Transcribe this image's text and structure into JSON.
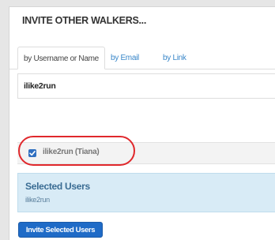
{
  "modal": {
    "title": "INVITE OTHER WALKERS..."
  },
  "tabs": [
    {
      "label": "by Username or Name",
      "active": true
    },
    {
      "label": "by Email",
      "active": false
    },
    {
      "label": "by Link",
      "active": false
    }
  ],
  "search": {
    "value": "ilike2run"
  },
  "results": [
    {
      "label": "ilike2run (Tiana)",
      "checked": true
    }
  ],
  "selected": {
    "title": "Selected Users",
    "users": [
      "ilike2run"
    ]
  },
  "actions": {
    "invite_label": "Invite Selected Users"
  },
  "colors": {
    "accent": "#1f6bc7",
    "link": "#3a87c9",
    "selected_bg": "#d8ebf6",
    "highlight": "#e0282c"
  }
}
